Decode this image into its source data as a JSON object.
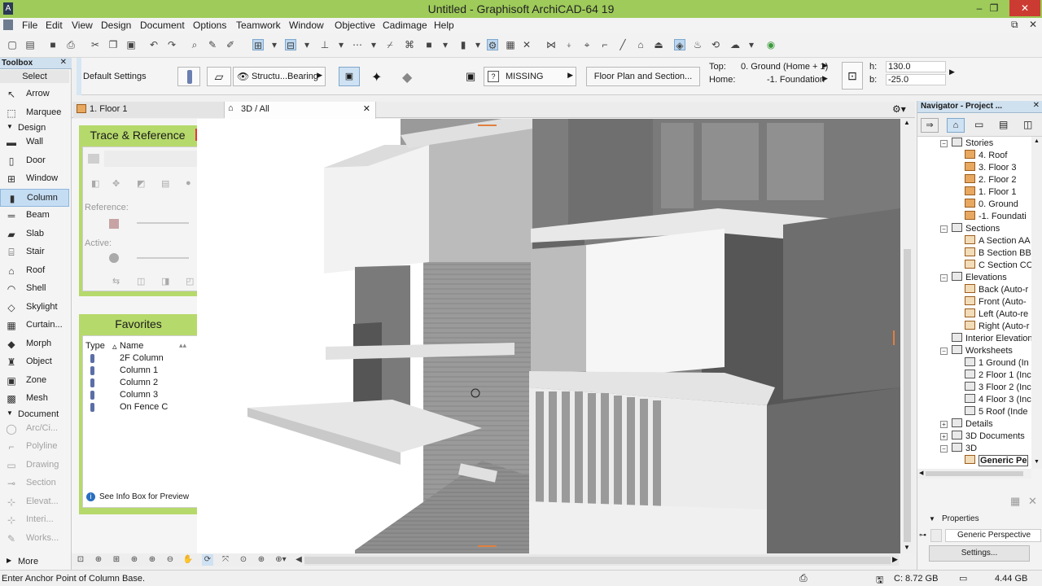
{
  "window": {
    "title": "Untitled - Graphisoft ArchiCAD-64 19",
    "app_icon": "archicad-icon"
  },
  "menu": [
    "File",
    "Edit",
    "View",
    "Design",
    "Document",
    "Options",
    "Teamwork",
    "Window",
    "Objective",
    "Cadimage",
    "Help"
  ],
  "toolbox": {
    "title": "Toolbox",
    "select_label": "Select",
    "select_items": [
      {
        "label": "Arrow",
        "icon": "arrow-icon"
      },
      {
        "label": "Marquee",
        "icon": "marquee-icon"
      }
    ],
    "design_label": "Design",
    "design_items": [
      {
        "label": "Wall",
        "icon": "wall-icon"
      },
      {
        "label": "Door",
        "icon": "door-icon"
      },
      {
        "label": "Window",
        "icon": "window-icon"
      },
      {
        "label": "Column",
        "icon": "column-icon"
      },
      {
        "label": "Beam",
        "icon": "beam-icon"
      },
      {
        "label": "Slab",
        "icon": "slab-icon"
      },
      {
        "label": "Stair",
        "icon": "stair-icon"
      },
      {
        "label": "Roof",
        "icon": "roof-icon"
      },
      {
        "label": "Shell",
        "icon": "shell-icon"
      },
      {
        "label": "Skylight",
        "icon": "skylight-icon"
      },
      {
        "label": "Curtain...",
        "icon": "curtain-wall-icon"
      },
      {
        "label": "Morph",
        "icon": "morph-icon"
      },
      {
        "label": "Object",
        "icon": "object-icon"
      },
      {
        "label": "Zone",
        "icon": "zone-icon"
      },
      {
        "label": "Mesh",
        "icon": "mesh-icon"
      }
    ],
    "selected": "Column",
    "document_label": "Document",
    "document_items": [
      {
        "label": "Arc/Ci...",
        "icon": "arc-icon"
      },
      {
        "label": "Polyline",
        "icon": "polyline-icon"
      },
      {
        "label": "Drawing",
        "icon": "drawing-icon"
      },
      {
        "label": "Section",
        "icon": "section-icon"
      },
      {
        "label": "Elevat...",
        "icon": "elevation-icon"
      },
      {
        "label": "Interi...",
        "icon": "interior-elevation-icon"
      },
      {
        "label": "Works...",
        "icon": "worksheet-icon"
      }
    ],
    "more_label": "More"
  },
  "infobox": {
    "default_settings": "Default Settings",
    "structural": "Structu...Bearing",
    "missing": "MISSING",
    "missing_prefix": "?",
    "floor_plan": "Floor Plan and Section...",
    "top_label": "Top:",
    "top_value": "0. Ground (Home + 1)",
    "home_label": "Home:",
    "home_value": "-1. Foundation",
    "h_label": "h:",
    "h_value": "130.0",
    "b_label": "b:",
    "b_value": "-25.0"
  },
  "tabs": [
    {
      "label": "1. Floor 1",
      "icon": "floor-plan-icon"
    },
    {
      "label": "3D / All",
      "icon": "3d-icon",
      "active": true
    }
  ],
  "trace_panel": {
    "title": "Trace & Reference",
    "reference_label": "Reference:",
    "active_label": "Active:"
  },
  "favorites": {
    "title": "Favorites",
    "col_type": "Type",
    "col_name": "Name",
    "items": [
      "2F Column",
      "Column 1",
      "Column 2",
      "Column 3",
      "On Fence C"
    ],
    "footer": "See Info Box for Preview"
  },
  "navigator": {
    "title": "Navigator - Project ...",
    "rows": [
      {
        "label": "Stories",
        "level": 1,
        "icon": "folder",
        "toggle": "−"
      },
      {
        "label": "4. Roof",
        "level": 2,
        "icon": "story"
      },
      {
        "label": "3. Floor 3",
        "level": 2,
        "icon": "story"
      },
      {
        "label": "2. Floor 2",
        "level": 2,
        "icon": "story"
      },
      {
        "label": "1. Floor 1",
        "level": 2,
        "icon": "story"
      },
      {
        "label": "0. Ground",
        "level": 2,
        "icon": "story"
      },
      {
        "label": "-1. Foundati",
        "level": 2,
        "icon": "story"
      },
      {
        "label": "Sections",
        "level": 1,
        "icon": "folder",
        "toggle": "−"
      },
      {
        "label": "A Section AA",
        "level": 2,
        "icon": "section"
      },
      {
        "label": "B Section BB",
        "level": 2,
        "icon": "section"
      },
      {
        "label": "C Section CC",
        "level": 2,
        "icon": "section"
      },
      {
        "label": "Elevations",
        "level": 1,
        "icon": "folder",
        "toggle": "−"
      },
      {
        "label": "Back (Auto-r",
        "level": 2,
        "icon": "section"
      },
      {
        "label": "Front (Auto-",
        "level": 2,
        "icon": "section"
      },
      {
        "label": "Left (Auto-re",
        "level": 2,
        "icon": "section"
      },
      {
        "label": "Right (Auto-r",
        "level": 2,
        "icon": "section"
      },
      {
        "label": "Interior Elevation",
        "level": 1,
        "icon": "folder"
      },
      {
        "label": "Worksheets",
        "level": 1,
        "icon": "folder",
        "toggle": "−"
      },
      {
        "label": "1 Ground (In",
        "level": 2,
        "icon": "worksheet"
      },
      {
        "label": "2 Floor 1 (Inc",
        "level": 2,
        "icon": "worksheet"
      },
      {
        "label": "3 Floor 2 (Inc",
        "level": 2,
        "icon": "worksheet"
      },
      {
        "label": "4 Floor 3 (Inc",
        "level": 2,
        "icon": "worksheet"
      },
      {
        "label": "5 Roof (Inde",
        "level": 2,
        "icon": "worksheet"
      },
      {
        "label": "Details",
        "level": 1,
        "icon": "folder",
        "toggle": "+"
      },
      {
        "label": "3D Documents",
        "level": 1,
        "icon": "folder",
        "toggle": "+"
      },
      {
        "label": "3D",
        "level": 1,
        "icon": "folder",
        "toggle": "−"
      },
      {
        "label": "Generic Pe",
        "level": 2,
        "icon": "perspective",
        "selected": true
      }
    ],
    "properties_label": "Properties",
    "properties_value": "Generic Perspective",
    "settings_label": "Settings..."
  },
  "status": {
    "prompt": "Enter Anchor Point of Column Base.",
    "disk_c": "C: 8.72 GB",
    "disk_other": "4.44 GB"
  }
}
